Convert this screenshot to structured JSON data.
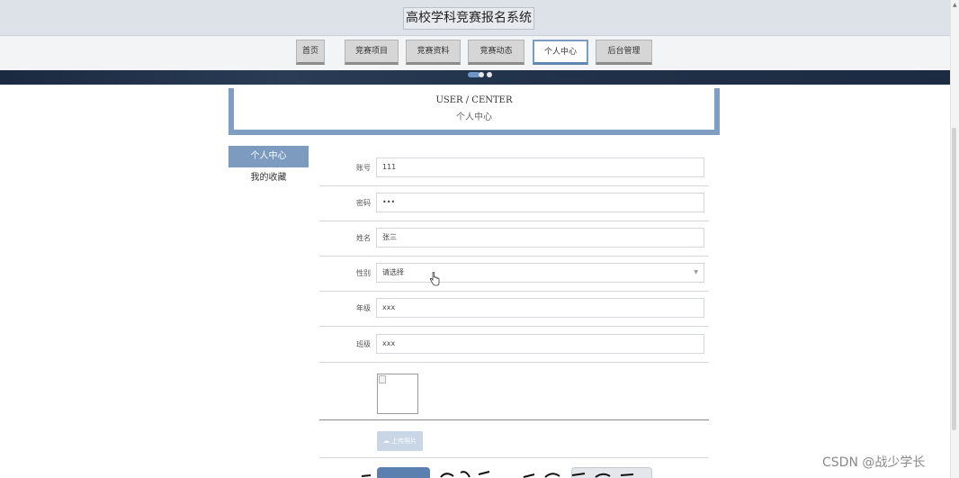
{
  "header": {
    "title": "高校学科竞赛报名系统"
  },
  "nav": {
    "tabs": [
      {
        "label": "首页"
      },
      {
        "label": "竞赛项目"
      },
      {
        "label": "竞赛资料"
      },
      {
        "label": "竞赛动态"
      },
      {
        "label": "个人中心",
        "active": true
      },
      {
        "label": "后台管理"
      }
    ]
  },
  "section": {
    "title_en": "USER / CENTER",
    "title_cn": "个人中心"
  },
  "sidebar": {
    "items": [
      {
        "label": "个人中心",
        "active": true
      },
      {
        "label": "我的收藏"
      }
    ]
  },
  "form": {
    "fields": [
      {
        "label": "账号",
        "value": "111"
      },
      {
        "label": "密码",
        "value": "•••"
      },
      {
        "label": "姓名",
        "value": "张三"
      },
      {
        "label": "性别",
        "value": "请选择",
        "type": "select"
      },
      {
        "label": "年级",
        "value": "xxx"
      },
      {
        "label": "班级",
        "value": "xxx"
      }
    ],
    "upload_label": "上传照片"
  },
  "watermark": "CSDN @战少学长",
  "colors": {
    "accent": "#7d9bbf",
    "banner": "#1f3047",
    "header_bg": "#dde2e8"
  },
  "icons": {
    "cursor": "hand-pointer-icon",
    "upload": "upload-icon",
    "broken_image": "broken-image-icon"
  }
}
